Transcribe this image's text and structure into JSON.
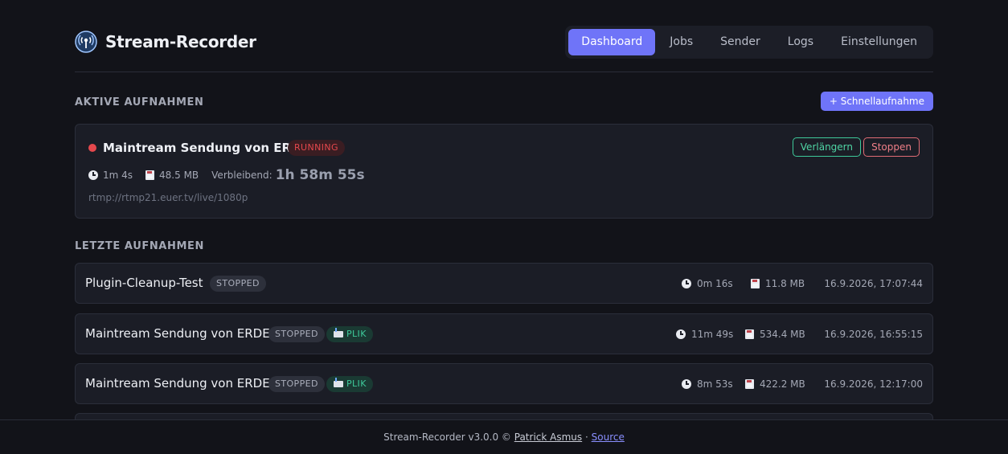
{
  "app": {
    "title": "Stream-Recorder"
  },
  "nav": {
    "items": [
      {
        "label": "Dashboard",
        "active": true
      },
      {
        "label": "Jobs"
      },
      {
        "label": "Sender"
      },
      {
        "label": "Logs"
      },
      {
        "label": "Einstellungen"
      }
    ]
  },
  "active_section": {
    "title": "AKTIVE AUFNAHMEN",
    "quick_button": "+ Schnellaufnahme",
    "recording": {
      "title": "Maintream Sendung von ERDE",
      "status": "RUNNING",
      "duration": "1m 4s",
      "size": "48.5 MB",
      "remaining_label": "Verbleibend:",
      "remaining_value": "1h 58m 55s",
      "url": "rtmp://rtmp21.euer.tv/live/1080p",
      "extend_label": "Verlängern",
      "stop_label": "Stoppen"
    }
  },
  "recent_section": {
    "title": "LETZTE AUFNAHMEN",
    "items": [
      {
        "name": "Plugin-Cleanup-Test",
        "status": "STOPPED",
        "duration": "0m 16s",
        "size": "11.8 MB",
        "date": "16.9.2026, 17:07:44"
      },
      {
        "name": "Maintream Sendung von ERDE",
        "status": "STOPPED",
        "plik": "PLIK",
        "duration": "11m 49s",
        "size": "534.4 MB",
        "date": "16.9.2026, 16:55:15"
      },
      {
        "name": "Maintream Sendung von ERDE",
        "status": "STOPPED",
        "plik": "PLIK",
        "duration": "8m 53s",
        "size": "422.2 MB",
        "date": "16.9.2026, 12:17:00"
      }
    ]
  },
  "footer": {
    "text": "Stream-Recorder v3.0.0 ©",
    "author": "Patrick Asmus",
    "separator": "·",
    "source": "Source"
  },
  "colors": {
    "accent": "#6f74f8",
    "running": "#e5484d",
    "success": "#3ec99a"
  }
}
